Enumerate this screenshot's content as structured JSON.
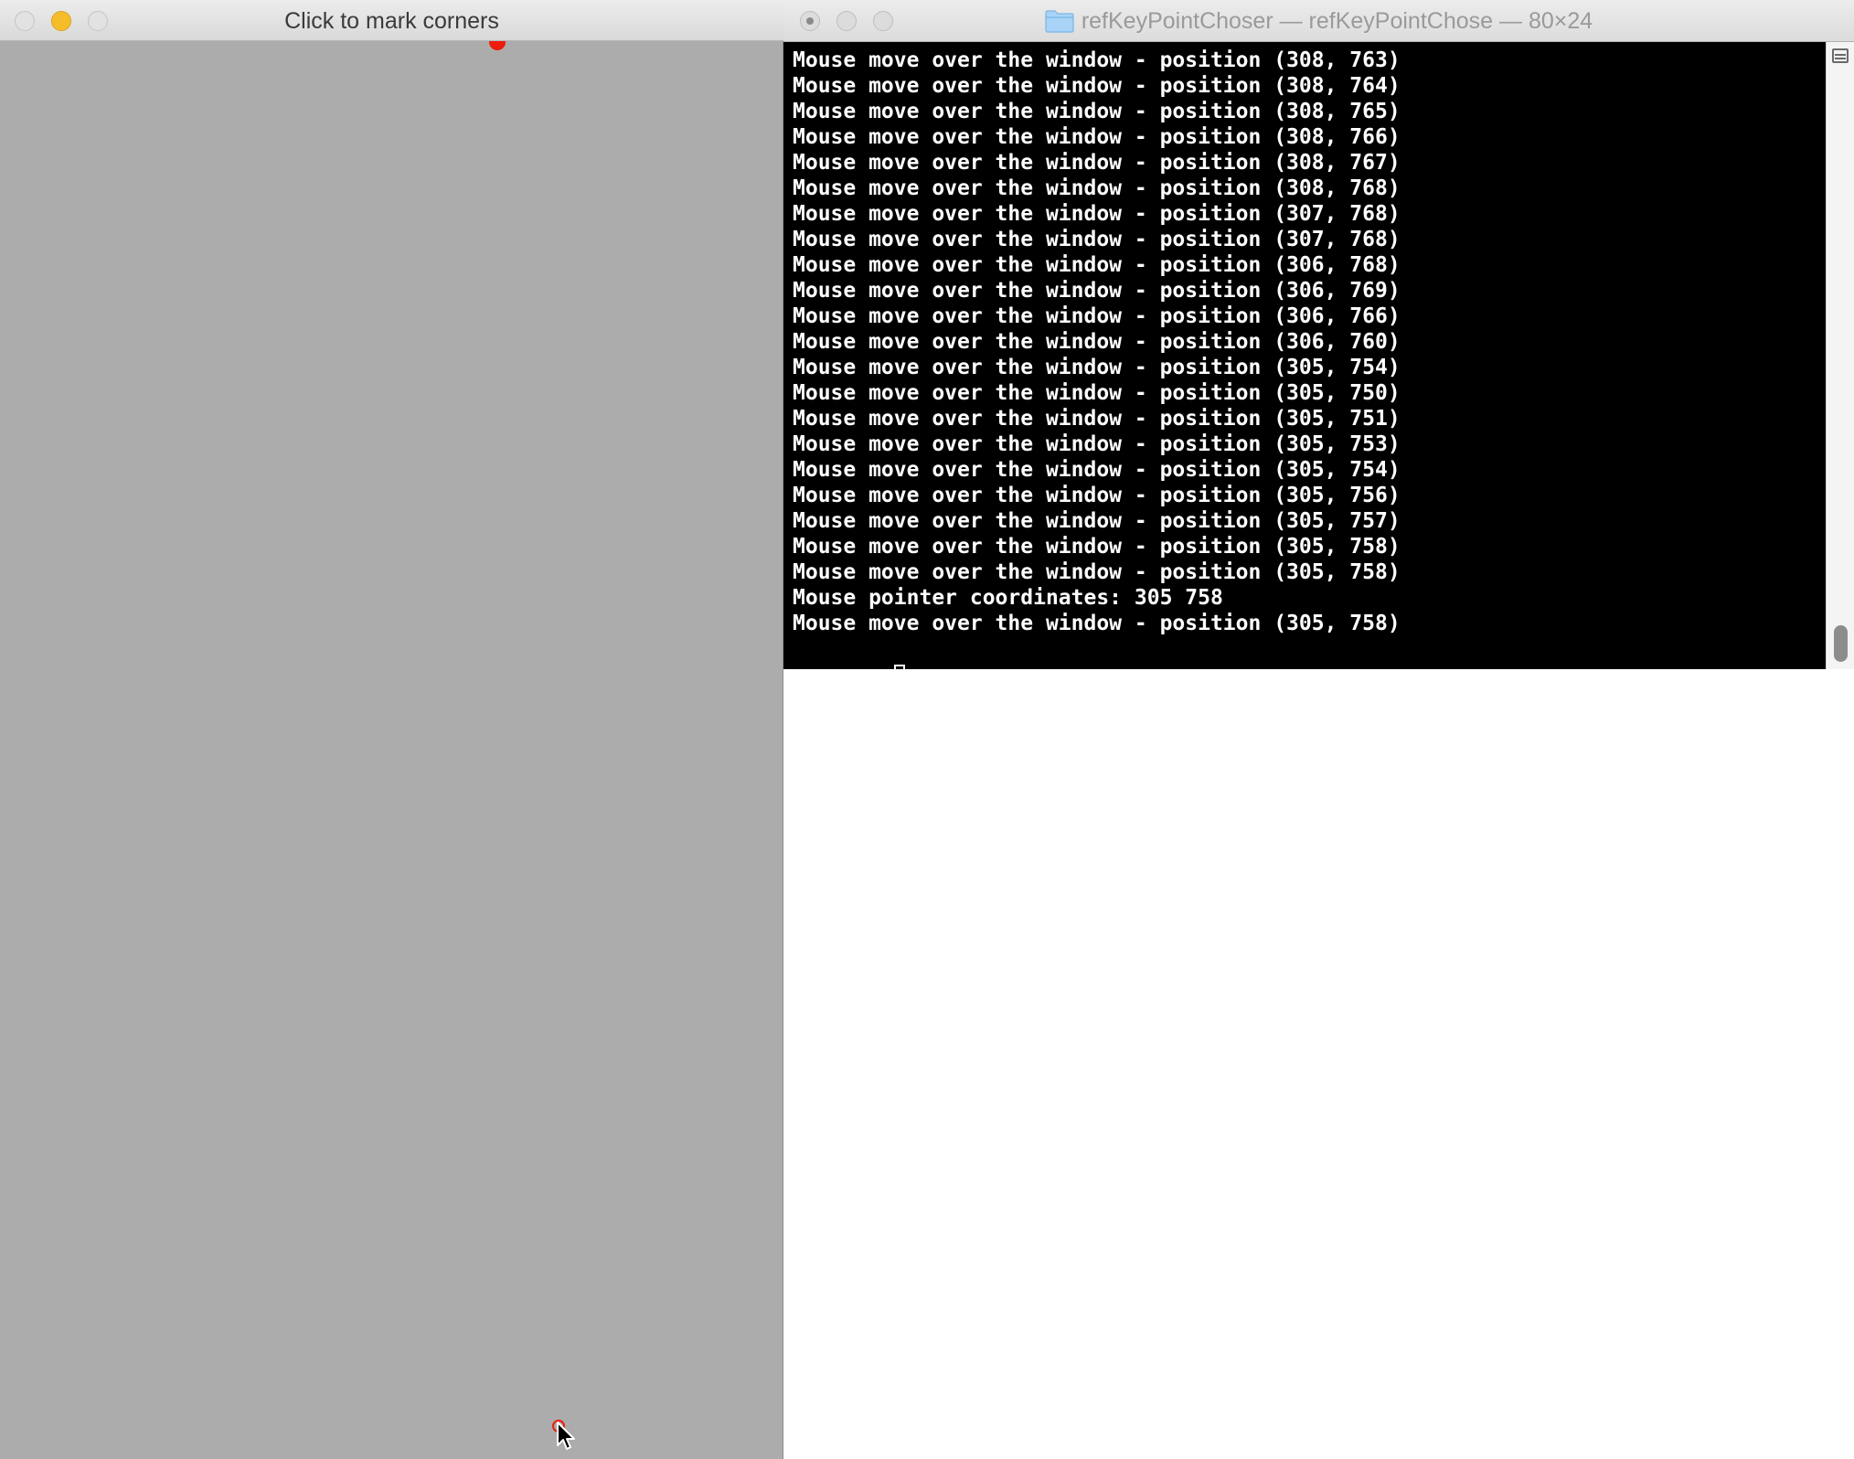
{
  "left_window": {
    "title": "Click to mark corners",
    "marker_color": "#ee1c0c",
    "background_color": "#acacac"
  },
  "terminal_window": {
    "title": "refKeyPointChoser — refKeyPointChose — 80×24",
    "folder_icon": "folder-icon",
    "lines": [
      "Mouse move over the window - position (308, 763)",
      "Mouse move over the window - position (308, 764)",
      "Mouse move over the window - position (308, 765)",
      "Mouse move over the window - position (308, 766)",
      "Mouse move over the window - position (308, 767)",
      "Mouse move over the window - position (308, 768)",
      "Mouse move over the window - position (307, 768)",
      "Mouse move over the window - position (307, 768)",
      "Mouse move over the window - position (306, 768)",
      "Mouse move over the window - position (306, 769)",
      "Mouse move over the window - position (306, 766)",
      "Mouse move over the window - position (306, 760)",
      "Mouse move over the window - position (305, 754)",
      "Mouse move over the window - position (305, 750)",
      "Mouse move over the window - position (305, 751)",
      "Mouse move over the window - position (305, 753)",
      "Mouse move over the window - position (305, 754)",
      "Mouse move over the window - position (305, 756)",
      "Mouse move over the window - position (305, 757)",
      "Mouse move over the window - position (305, 758)",
      "Mouse move over the window - position (305, 758)",
      "Mouse pointer coordinates: 305 758",
      "Mouse move over the window - position (305, 758)"
    ]
  }
}
